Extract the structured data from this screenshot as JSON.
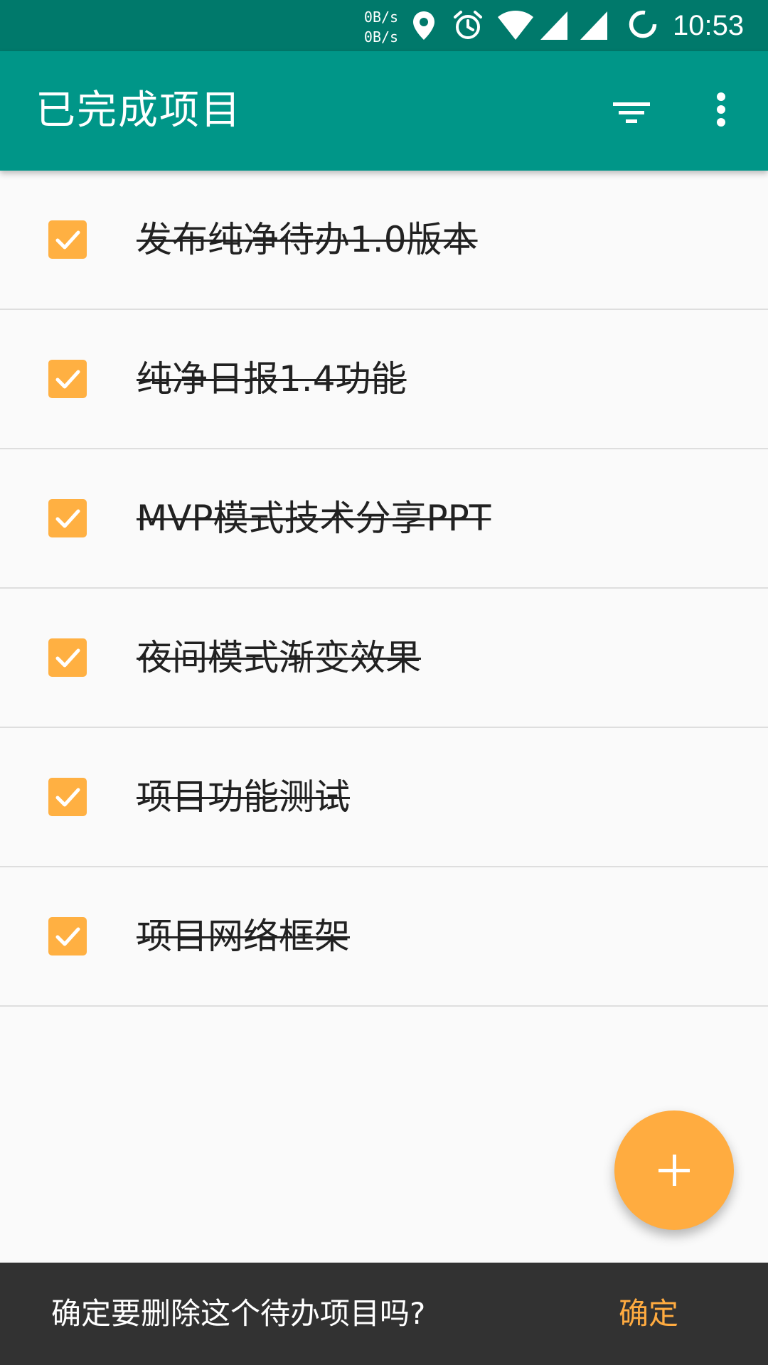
{
  "status_bar": {
    "net_up": "0B/s",
    "net_down": "0B/s",
    "time": "10:53",
    "icons": [
      "location-icon",
      "alarm-icon",
      "wifi-icon",
      "signal-icon",
      "signal-icon",
      "loading-icon"
    ]
  },
  "app_bar": {
    "title": "已完成项目",
    "actions": [
      "filter-icon",
      "more-vert-icon"
    ]
  },
  "items": [
    {
      "label": "发布纯净待办1.0版本",
      "checked": true
    },
    {
      "label": "纯净日报1.4功能",
      "checked": true
    },
    {
      "label": "MVP模式技术分享PPT",
      "checked": true
    },
    {
      "label": "夜间模式渐变效果",
      "checked": true
    },
    {
      "label": "项目功能测试",
      "checked": true
    },
    {
      "label": "项目网络框架",
      "checked": true
    }
  ],
  "fab": {
    "icon": "add-icon"
  },
  "snackbar": {
    "message": "确定要删除这个待办项目吗?",
    "action": "确定"
  },
  "colors": {
    "status_bar": "#00796b",
    "app_bar": "#009688",
    "accent": "#ffab40",
    "checkbox": "#ffb042",
    "snackbar": "#323232"
  }
}
